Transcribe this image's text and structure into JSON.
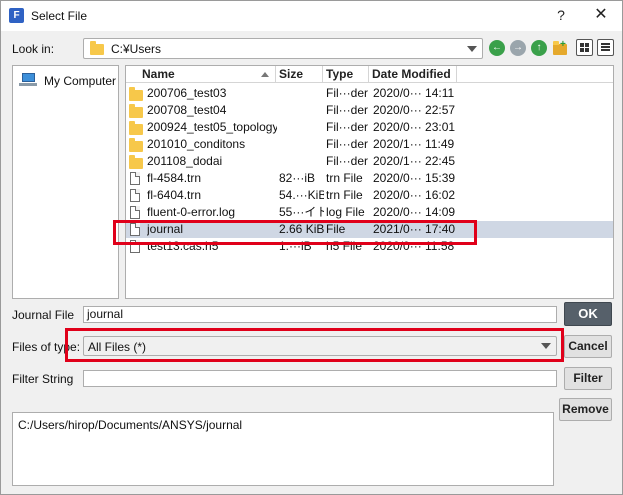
{
  "window": {
    "title": "Select File",
    "app_icon_letter": "F",
    "help_label": "?",
    "close_label": "✕"
  },
  "lookin": {
    "label": "Look in:",
    "value": "C:¥Users"
  },
  "sidebar": {
    "items": [
      {
        "label": "My Computer",
        "icon": "computer-icon"
      }
    ]
  },
  "filelist": {
    "columns": [
      "Name",
      "Size",
      "Type",
      "Date Modified"
    ],
    "rows": [
      {
        "kind": "folder",
        "name": "200706_test03",
        "size": "",
        "type": "Fil···der",
        "date": "2020/0··· 14:11"
      },
      {
        "kind": "folder",
        "name": "200708_test04",
        "size": "",
        "type": "Fil···der",
        "date": "2020/0··· 22:57"
      },
      {
        "kind": "folder",
        "name": "200924_test05_topology",
        "size": "",
        "type": "Fil···der",
        "date": "2020/0··· 23:01"
      },
      {
        "kind": "folder",
        "name": "201010_conditons",
        "size": "",
        "type": "Fil···der",
        "date": "2020/1··· 11:49"
      },
      {
        "kind": "folder",
        "name": "201108_dodai",
        "size": "",
        "type": "Fil···der",
        "date": "2020/1··· 22:45"
      },
      {
        "kind": "file",
        "name": "fl-4584.trn",
        "size": "82···iB",
        "type": "trn File",
        "date": "2020/0··· 15:39"
      },
      {
        "kind": "file",
        "name": "fl-6404.trn",
        "size": "54.···KiB",
        "type": "trn File",
        "date": "2020/0··· 16:02"
      },
      {
        "kind": "file",
        "name": "fluent-0-error.log",
        "size": "55···イト",
        "type": "log File",
        "date": "2020/0··· 14:09"
      },
      {
        "kind": "file",
        "name": "journal",
        "size": "2.66 KiB",
        "type": "File",
        "date": "2021/0··· 17:40",
        "selected": true
      },
      {
        "kind": "file",
        "name": "test13.cas.h5",
        "size": "1.···iB",
        "type": "h5 File",
        "date": "2020/0··· 11:58"
      }
    ]
  },
  "journal_file": {
    "label": "Journal File",
    "value": "journal"
  },
  "file_type": {
    "label": "Files of type:",
    "value": "All Files (*)"
  },
  "filter_string": {
    "label": "Filter String",
    "value": ""
  },
  "buttons": {
    "ok": "OK",
    "cancel": "Cancel",
    "filter": "Filter",
    "remove": "Remove"
  },
  "selected_path": "C:/Users/hirop/Documents/ANSYS/journal",
  "colors": {
    "highlight": "#e0001a",
    "selected_row": "#cfd7e4",
    "folder": "#f7c84a",
    "ok_button": "#56606a"
  }
}
